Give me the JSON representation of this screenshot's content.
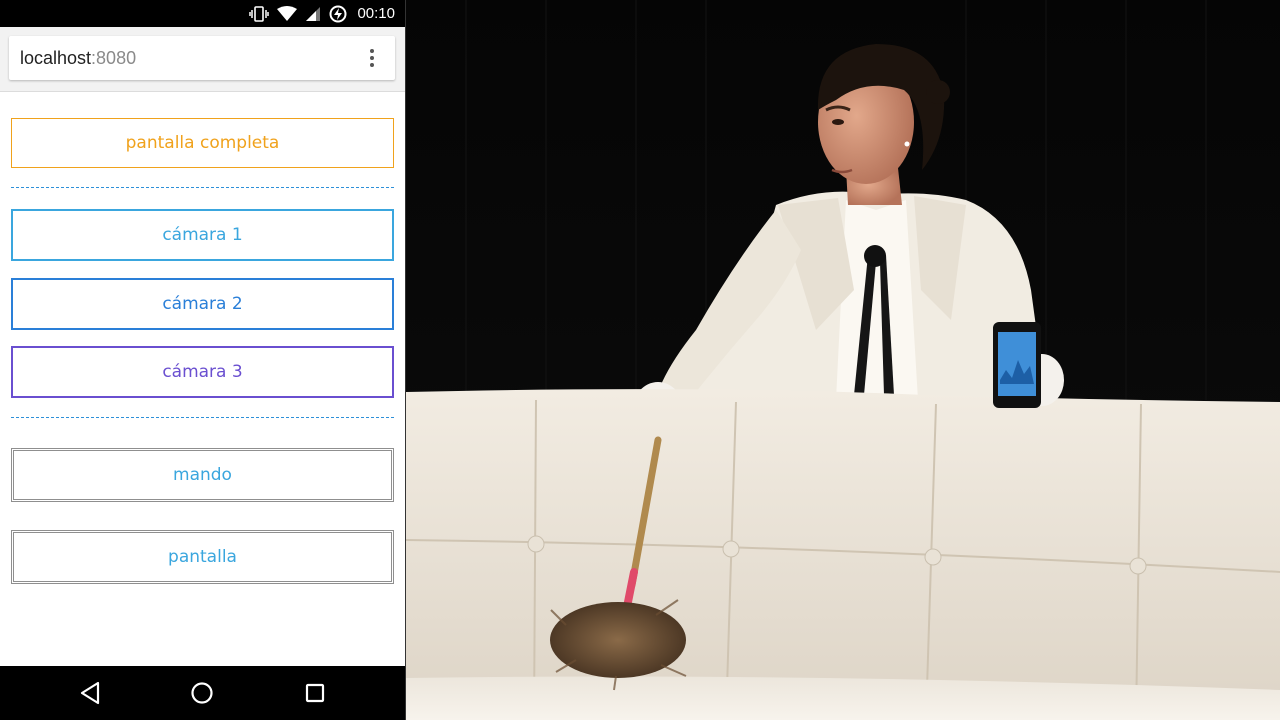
{
  "status_bar": {
    "time": "00:10",
    "icons": [
      "vibrate-icon",
      "wifi-icon",
      "cell-signal-icon",
      "battery-charging-icon"
    ]
  },
  "browser": {
    "url_host": "localhost",
    "url_port": ":8080",
    "menu_icon": "overflow-menu-icon"
  },
  "buttons": {
    "fullscreen": "pantalla completa",
    "camera1": "cámara 1",
    "camera2": "cámara 2",
    "camera3": "cámara 3",
    "remote": "mando",
    "screen": "pantalla"
  },
  "colors": {
    "fullscreen": "#f0a21c",
    "camera1": "#3aa6de",
    "camera2": "#2a7fd8",
    "camera3": "#6a4fd0",
    "divider": "#2d90d9"
  },
  "navbar": {
    "icons": [
      "back-icon",
      "home-icon",
      "recents-icon"
    ]
  },
  "stage": {
    "subject": "woman in white suit holding feather duster and smartphone behind white tufted sofa"
  }
}
